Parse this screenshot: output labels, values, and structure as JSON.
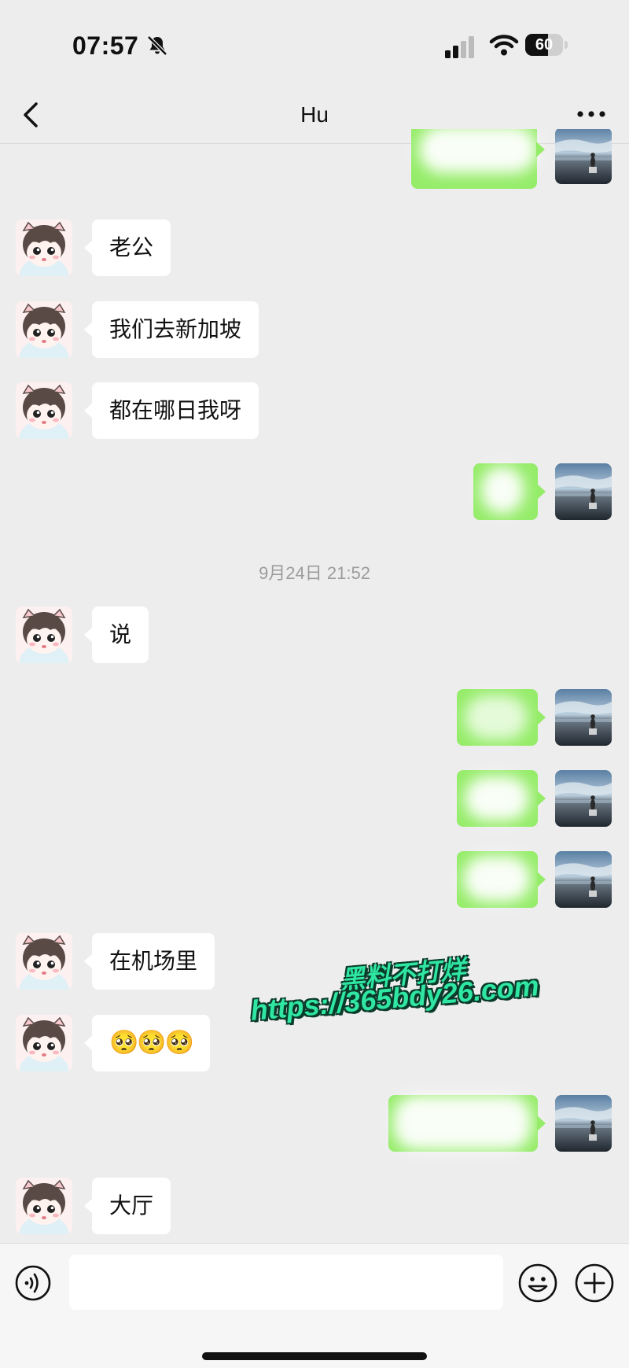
{
  "status_bar": {
    "time": "07:57",
    "battery": "60",
    "battery_level": 0.6
  },
  "header": {
    "title": "Hu",
    "back_icon": "chevron-left-icon",
    "more_icon": "ellipsis-icon"
  },
  "messages": [
    {
      "side": "right",
      "text": ""
    },
    {
      "side": "left",
      "text": "老公"
    },
    {
      "side": "left",
      "text": "我们去新加坡"
    },
    {
      "side": "left",
      "text": "都在哪日我呀"
    },
    {
      "side": "right",
      "text": ""
    },
    {
      "side": "left",
      "text": "说"
    },
    {
      "side": "right",
      "text": ""
    },
    {
      "side": "right",
      "text": ""
    },
    {
      "side": "right",
      "text": ""
    },
    {
      "side": "left",
      "text": "在机场里"
    },
    {
      "side": "left",
      "text": "🥺🥺🥺"
    },
    {
      "side": "right",
      "text": ""
    },
    {
      "side": "left",
      "text": "大厅"
    }
  ],
  "timestamp": "9月24日 21:52",
  "watermark": {
    "line1": "黑料不打烊",
    "line2": "https://365bdy26.com"
  },
  "input_bar": {
    "value": "",
    "voice_icon": "voice-icon",
    "emoji_icon": "emoji-icon",
    "plus_icon": "plus-icon"
  },
  "colors": {
    "outgoing_bubble": "#95ec69",
    "incoming_bubble": "#ffffff",
    "background": "#ededed"
  }
}
